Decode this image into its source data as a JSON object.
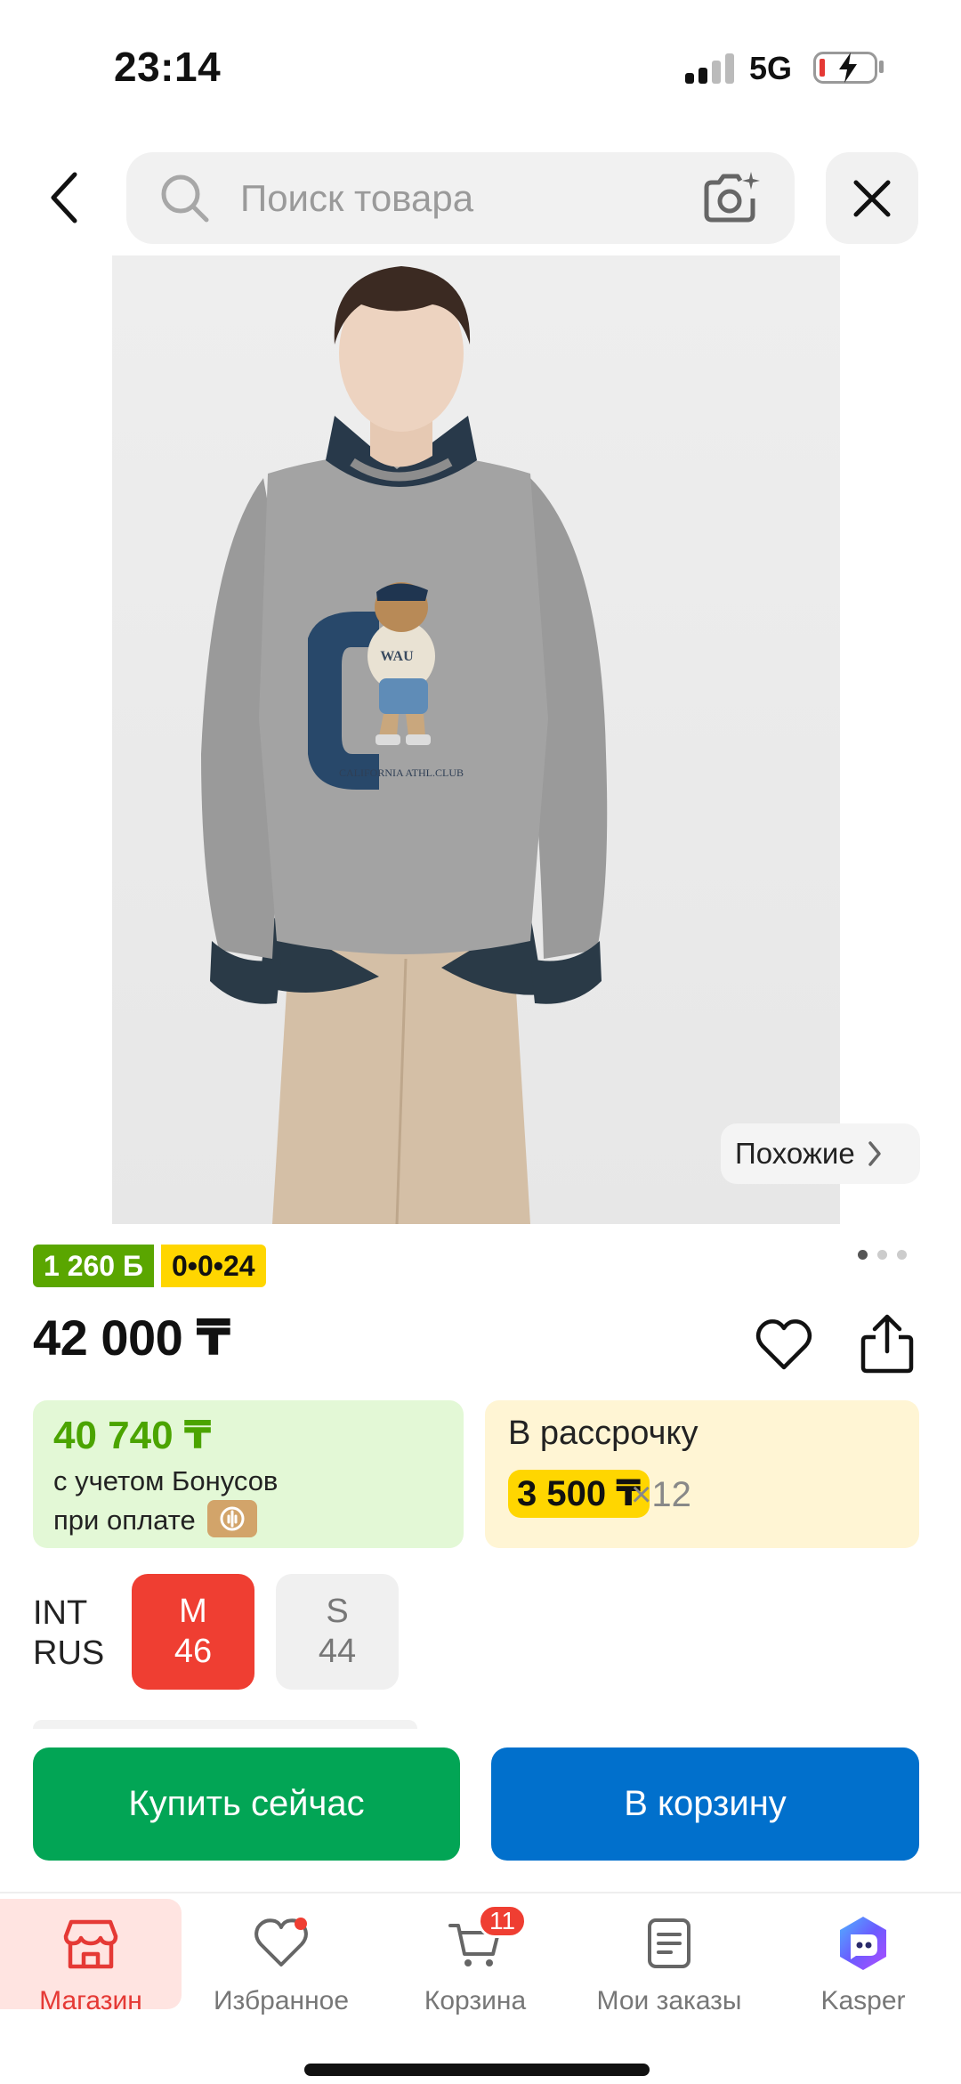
{
  "status_bar": {
    "time": "23:14",
    "network": "5G"
  },
  "header": {
    "search_placeholder": "Поиск товара"
  },
  "product": {
    "similar_label": "Похожие",
    "bonus_badge": "1 260 Б",
    "installment_badge": "0•0•24",
    "price": "42 000 ₸",
    "image_pages": 3,
    "image_page_active": 1,
    "print_text": "WAU",
    "print_caption": "CALIFORNIA ATHL.CLUB"
  },
  "bonus_card": {
    "price": "40 740 ₸",
    "line1": "с учетом Бонусов",
    "line2": "при оплате"
  },
  "installment_card": {
    "title": "В рассрочку",
    "amount": "3 500 ₸",
    "times": "×12"
  },
  "sizes": {
    "systems": [
      "INT",
      "RUS"
    ],
    "options": [
      {
        "int": "M",
        "rus": "46",
        "selected": true
      },
      {
        "int": "S",
        "rus": "44",
        "selected": false
      }
    ]
  },
  "actions": {
    "buy_now": "Купить сейчас",
    "add_to_cart": "В корзину"
  },
  "tabbar": {
    "items": [
      {
        "label": "Магазин",
        "icon": "store-icon",
        "active": true
      },
      {
        "label": "Избранное",
        "icon": "heart-icon"
      },
      {
        "label": "Корзина",
        "icon": "cart-icon",
        "badge": "11"
      },
      {
        "label": "Мои заказы",
        "icon": "orders-icon"
      },
      {
        "label": "Kasper",
        "icon": "kasper-assistant-icon"
      }
    ]
  },
  "colors": {
    "accent_red": "#ef3e32",
    "buy_green": "#02a555",
    "cart_blue": "#0170cc",
    "bonus_green": "#4ba400",
    "installment_yellow": "#ffd600"
  }
}
